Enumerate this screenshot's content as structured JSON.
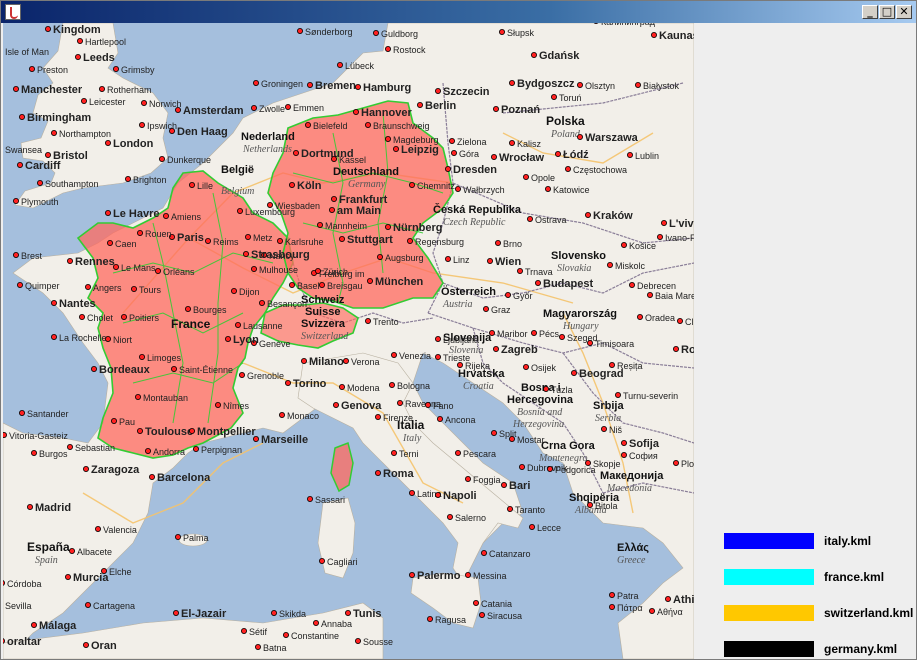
{
  "window": {
    "title": "",
    "buttons": {
      "minimize": "_",
      "maximize": "□",
      "close": "✕"
    }
  },
  "map": {
    "countries": {
      "deutschland": "Deutschland",
      "germany": "Germany",
      "france": "France",
      "belgie": "België",
      "belgium": "Belgium",
      "nederland": "Nederland",
      "netherlands": "Netherlands",
      "schweiz": "Schweiz",
      "suisse": "Suisse",
      "svizzera": "Svizzera",
      "switzerland": "Switzerland",
      "osterreich": "Österreich",
      "austria": "Austria",
      "italia": "Italia",
      "italy": "Italy",
      "polska": "Polska",
      "poland": "Poland",
      "ceska": "Česká Republika",
      "czech": "Czech Republic",
      "slovensko": "Slovensko",
      "slovakia": "Slovakia",
      "magyarorszag": "Magyarország",
      "hungary": "Hungary",
      "slovenija": "Slovenija",
      "slovenia": "Slovenia",
      "hrvatska": "Hrvatska",
      "croatia": "Croatia",
      "bosna": "Bosna i",
      "hercegovina": "Hercegovina",
      "bosnia": "Bosnia and",
      "herzegovina": "Herzegovina",
      "srbija": "Srbija",
      "serbia": "Serbia",
      "crnagora": "Crna Gora",
      "montenegro": "Montenegro",
      "makedonija": "Македонија",
      "macedonia": "Macedonia",
      "shqiperia": "Shqipëria",
      "albania": "Albania",
      "espana": "España",
      "spain": "Spain",
      "ellas": "Ελλάς",
      "greece": "Greece"
    },
    "cities": {
      "kingdom": "Kingdom",
      "hartlepool": "Hartlepool",
      "isle_of_man": "Isle of Man",
      "leeds": "Leeds",
      "preston": "Preston",
      "grimsby": "Grimsby",
      "manchester": "Manchester",
      "rotherham": "Rotherham",
      "leicester": "Leicester",
      "norwich": "Norwich",
      "birmingham": "Birmingham",
      "ipswich": "Ipswich",
      "northampton": "Northampton",
      "swansea": "Swansea",
      "london": "London",
      "bristol": "Bristol",
      "cardiff": "Cardiff",
      "brighton": "Brighton",
      "southampton": "Southampton",
      "plymouth": "Plymouth",
      "amsterdam": "Amsterdam",
      "denhaag": "Den Haag",
      "zwolle": "Zwolle",
      "emmen": "Emmen",
      "groningen": "Groningen",
      "bremen": "Bremen",
      "hamburg": "Hamburg",
      "sonderborg": "Sønderborg",
      "guldborg": "Guldborg",
      "rostock": "Rostock",
      "lubeck": "Lübeck",
      "szczecin": "Szczecin",
      "slupsk": "Słupsk",
      "gdansk": "Gdańsk",
      "olsztyn": "Olsztyn",
      "kaliningrad": "Калининград",
      "kaunas": "Kaunas",
      "bydgoszcz": "Bydgoszcz",
      "torun": "Toruń",
      "bialystok": "Białystok",
      "poznan": "Poznań",
      "warszawa": "Warszawa",
      "lodz": "Łódź",
      "lublin": "Lublin",
      "kalisz": "Kalisz",
      "wroclaw": "Wrocław",
      "opole": "Opole",
      "katowice": "Katowice",
      "czestochowa": "Częstochowa",
      "krakow": "Kraków",
      "lviv": "L'viv",
      "ivano": "Ivano-F",
      "kosice": "Košice",
      "miskolc": "Miskolc",
      "debrecen": "Debrecen",
      "baiamare": "Baia Mare",
      "oradea": "Oradea",
      "clu": "Clu",
      "budapest": "Budapest",
      "szeged": "Szeged",
      "timisoara": "Timișoara",
      "resita": "Reșița",
      "ro": "Ro",
      "turnu": "Turnu-severin",
      "beograd": "Beograd",
      "nis": "Niš",
      "sofija": "Sofija",
      "sofija_cyr": "София",
      "plovdiv": "Plo",
      "skopje": "Skopje",
      "bitola": "Bitola",
      "ellas_city": "Ελλάς",
      "athina": "Athina",
      "athina_gr": "Αθήνα",
      "patra": "Patra",
      "patra_gr": "Πάτρα",
      "hannover": "Hannover",
      "braunschweig": "Braunschweig",
      "berlin": "Berlin",
      "bielefeld": "Bielefeld",
      "magdeburg": "Magdeburg",
      "dortmund": "Dortmund",
      "leipzig": "Leipzig",
      "zielona": "Zielona",
      "gora": "Góra",
      "koln": "Köln",
      "kassel": "Kassel",
      "dresden": "Dresden",
      "chemnitz": "Chemnitz",
      "walbrzych": "Wałbrzych",
      "wiesbaden": "Wiesbaden",
      "frankfurt": "Frankfurt",
      "ammain": "am Main",
      "mannheim": "Mannheim",
      "karlsruhe": "Karlsruhe",
      "stuttgart": "Stuttgart",
      "nurnberg": "Nürnberg",
      "regensburg": "Regensburg",
      "augsburg": "Augsburg",
      "munchen": "München",
      "freiburg": "Freiburg im",
      "breisgau": "Breisgau",
      "linz": "Linz",
      "wien": "Wien",
      "brno": "Brno",
      "ostrava": "Ostrava",
      "trnava": "Trnava",
      "gyor": "Győr",
      "graz": "Graz",
      "maribor": "Maribor",
      "pecs": "Pécs",
      "ljubljana": "Ljubljana",
      "zagreb": "Zagreb",
      "osijek": "Osijek",
      "rijeka": "Rijeka",
      "tuzla": "Tuzla",
      "split": "Split",
      "mostar": "Mostar",
      "dubrovnik": "Dubrovnik",
      "podgorica": "Podgorica",
      "trento": "Trento",
      "venezia": "Venezia",
      "trieste": "Trieste",
      "milano": "Milano",
      "verona": "Verona",
      "torino": "Torino",
      "modena": "Modena",
      "bologna": "Bologna",
      "genova": "Genova",
      "ravenna": "Ravenna",
      "fano": "Fano",
      "ancona": "Ancona",
      "firenze": "Firenze",
      "pescara": "Pescara",
      "terni": "Terni",
      "roma": "Roma",
      "latina": "Latina",
      "napoli": "Napoli",
      "salerno": "Salerno",
      "foggia": "Foggia",
      "bari": "Bari",
      "taranto": "Taranto",
      "lecce": "Lecce",
      "catanzaro": "Catanzaro",
      "palermo": "Palermo",
      "messina": "Messina",
      "catania": "Catania",
      "siracusa": "Siracusa",
      "ragusa": "Ragusa",
      "sassari": "Sassari",
      "cagliari": "Cagliari",
      "paris": "Paris",
      "lehavre": "Le Havre",
      "rouen": "Rouen",
      "amiens": "Amiens",
      "caen": "Caen",
      "reims": "Reims",
      "lille": "Lille",
      "dunkerque": "Dunkerque",
      "luxembourg": "Luxembourg",
      "metz": "Metz",
      "nancy": "Nancy",
      "strasbourg": "Strasbourg",
      "mulhouse": "Mulhouse",
      "dijon": "Dijon",
      "besancon": "Besançon",
      "lausanne": "Lausanne",
      "geneve": "Genève",
      "lyon": "Lyon",
      "grenoble": "Grenoble",
      "brest": "Brest",
      "rennes": "Rennes",
      "lemans": "Le Mans",
      "angers": "Angers",
      "tours": "Tours",
      "orleans": "Orléans",
      "nantes": "Nantes",
      "cholet": "Cholet",
      "poitiers": "Poitiers",
      "bourges": "Bourges",
      "niort": "Niort",
      "larochelle": "La Rochelle",
      "limoges": "Limoges",
      "saintetienne": "Saint-Étienne",
      "bordeaux": "Bordeaux",
      "montauban": "Montauban",
      "toulouse": "Toulouse",
      "montpellier": "Montpellier",
      "nimes": "Nîmes",
      "marseille": "Marseille",
      "monaco": "Monaco",
      "perpignan": "Perpignan",
      "andorra": "Andorra",
      "quimper": "Quimper",
      "pau": "Pau",
      "santander": "Santander",
      "vitoria": "Vitoria-Gasteiz",
      "sebastian": "Sebastian",
      "burgos": "Burgos",
      "zaragoza": "Zaragoza",
      "barcelona": "Barcelona",
      "madrid": "Madrid",
      "palma": "Palma",
      "albacete": "Albacete",
      "valencia": "Valencia",
      "elche": "Elche",
      "murcia": "Murcia",
      "cordoba": "Córdoba",
      "cartagena": "Cartagena",
      "sevilla": "Sevilla",
      "malaga": "Málaga",
      "oran": "Oran",
      "eljazair": "El-Jazair",
      "tunis": "Tunis",
      "skikda": "Skikda",
      "annaba": "Annaba",
      "setif": "Sétif",
      "constantine": "Constantine",
      "sousse": "Sousse",
      "batna": "Batna",
      "gibraltar": "oraltar",
      "genf": "Ge",
      "zurich": "Zürich",
      "basel": "Basel"
    }
  },
  "legend": {
    "items": [
      {
        "label": "italy.kml",
        "color": "#0000ff"
      },
      {
        "label": "france.kml",
        "color": "#00ffff"
      },
      {
        "label": "switzerland.kml",
        "color": "#ffc800"
      },
      {
        "label": "germany.kml",
        "color": "#000000"
      }
    ]
  },
  "colors": {
    "sea": "#a5bfdd",
    "land": "#f2efe9",
    "overlay_fill": "#ff6a5e",
    "overlay_border": "#33cc33",
    "border": "#8a7e98",
    "road": "#f5c36b"
  }
}
